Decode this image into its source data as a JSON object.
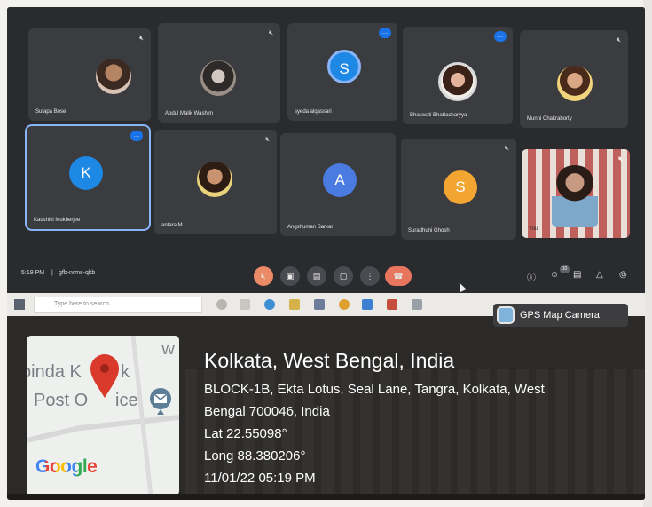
{
  "participants": [
    {
      "name": "Sutapa Bose",
      "kind": "photo",
      "mic_off": true
    },
    {
      "name": "Abdul Malik Washim",
      "kind": "photo",
      "mic_off": true
    },
    {
      "name": "syeda alqassari",
      "kind": "letter",
      "letter": "S",
      "color": "#1e88e5",
      "talking": true
    },
    {
      "name": "Bhaswati Bhattacharyya",
      "kind": "photo",
      "talking": true
    },
    {
      "name": "Munni Chakraborty",
      "kind": "photo",
      "mic_off": true
    },
    {
      "name": "Kaushiki Mukherjee",
      "kind": "letter",
      "letter": "K",
      "color": "#1e88e5",
      "talking": true,
      "active": true
    },
    {
      "name": "antara M",
      "kind": "photo",
      "mic_off": true
    },
    {
      "name": "Angshuman Sarkar",
      "kind": "letter",
      "letter": "A",
      "color": "#4a7be0",
      "mic_off": false
    },
    {
      "name": "Suradhuni Ghosh",
      "kind": "letter",
      "letter": "S",
      "color": "#f2a530",
      "mic_off": true
    },
    {
      "name": "You",
      "kind": "self",
      "mic_off": true
    }
  ],
  "meet_bar": {
    "time": "5:19 PM",
    "separator": "|",
    "meeting_code": "gfb-nrms-qkb",
    "participant_count": "10"
  },
  "controls": [
    "mic-off-icon",
    "camera-icon",
    "captions-icon",
    "present-icon",
    "more-icon",
    "hang-up-icon"
  ],
  "side_icons": [
    "info-icon",
    "people-icon",
    "chat-icon",
    "activities-icon",
    "host-controls-icon"
  ],
  "taskbar": {
    "search_placeholder": "Type here to search"
  },
  "gps": {
    "app_label": "GPS Map Camera",
    "title": "Kolkata, West Bengal, India",
    "address_line1": "BLOCK-1B, Ekta Lotus, Seal Lane, Tangra, Kolkata, West",
    "address_line2": "Bengal 700046, India",
    "lat": "Lat 22.55098°",
    "long": "Long 88.380206°",
    "datetime": "11/01/22 05:19 PM",
    "map_text_1": "binda K",
    "map_text_2": "k",
    "map_text_3": "Post O",
    "map_text_4": "ice",
    "map_w": "W",
    "google": "Google",
    "google_colors": [
      "#4285f4",
      "#ea4335",
      "#fbbc05",
      "#4285f4",
      "#34a853",
      "#ea4335"
    ]
  }
}
